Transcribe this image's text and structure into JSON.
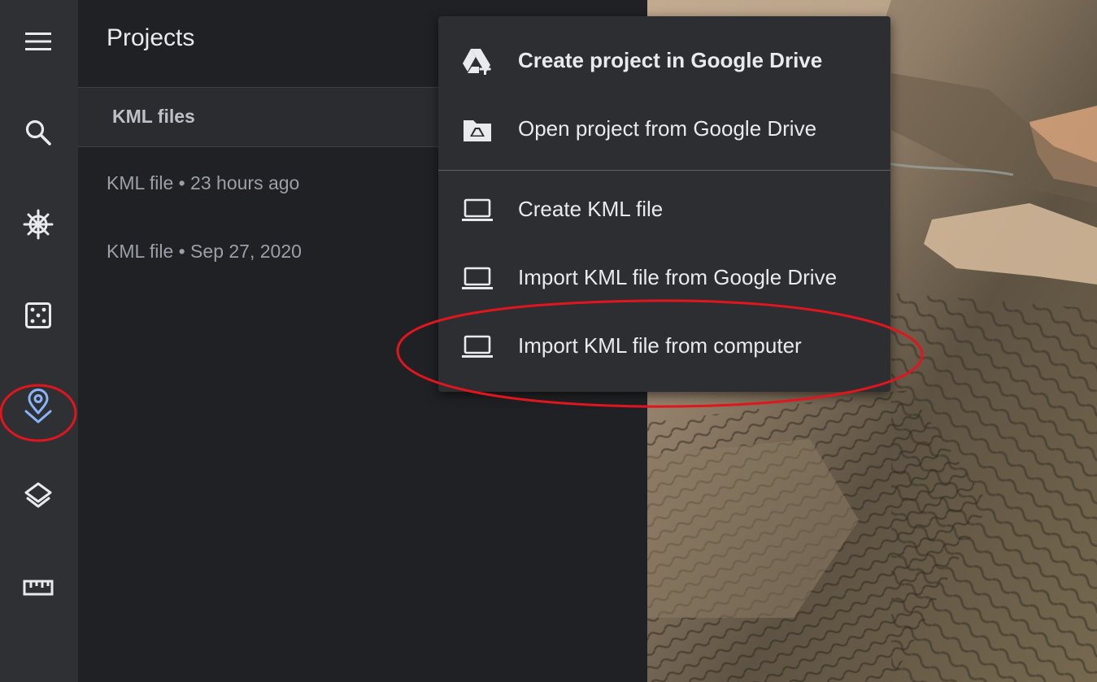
{
  "rail": {
    "items": [
      {
        "name": "menu-icon",
        "active": false
      },
      {
        "name": "search-icon",
        "active": false
      },
      {
        "name": "voyager-icon",
        "active": false
      },
      {
        "name": "feeling-lucky-icon",
        "active": false
      },
      {
        "name": "projects-icon",
        "active": true
      },
      {
        "name": "map-style-icon",
        "active": false
      },
      {
        "name": "measure-icon",
        "active": false
      }
    ],
    "active_color": "#8ab4f8"
  },
  "panel": {
    "title": "Projects",
    "section_label": "KML files",
    "files": [
      {
        "label": "KML file • 23 hours ago"
      },
      {
        "label": "KML file • Sep 27, 2020"
      }
    ]
  },
  "menu": {
    "items": [
      {
        "label": "Create project in Google Drive",
        "icon": "drive-add-icon"
      },
      {
        "label": "Open project from Google Drive",
        "icon": "drive-folder-icon"
      },
      {
        "label": "Create KML file",
        "icon": "laptop-icon"
      },
      {
        "label": "Import KML file from Google Drive",
        "icon": "laptop-icon"
      },
      {
        "label": "Import KML file from computer",
        "icon": "laptop-icon"
      }
    ]
  },
  "annotation_color": "#e0161e"
}
